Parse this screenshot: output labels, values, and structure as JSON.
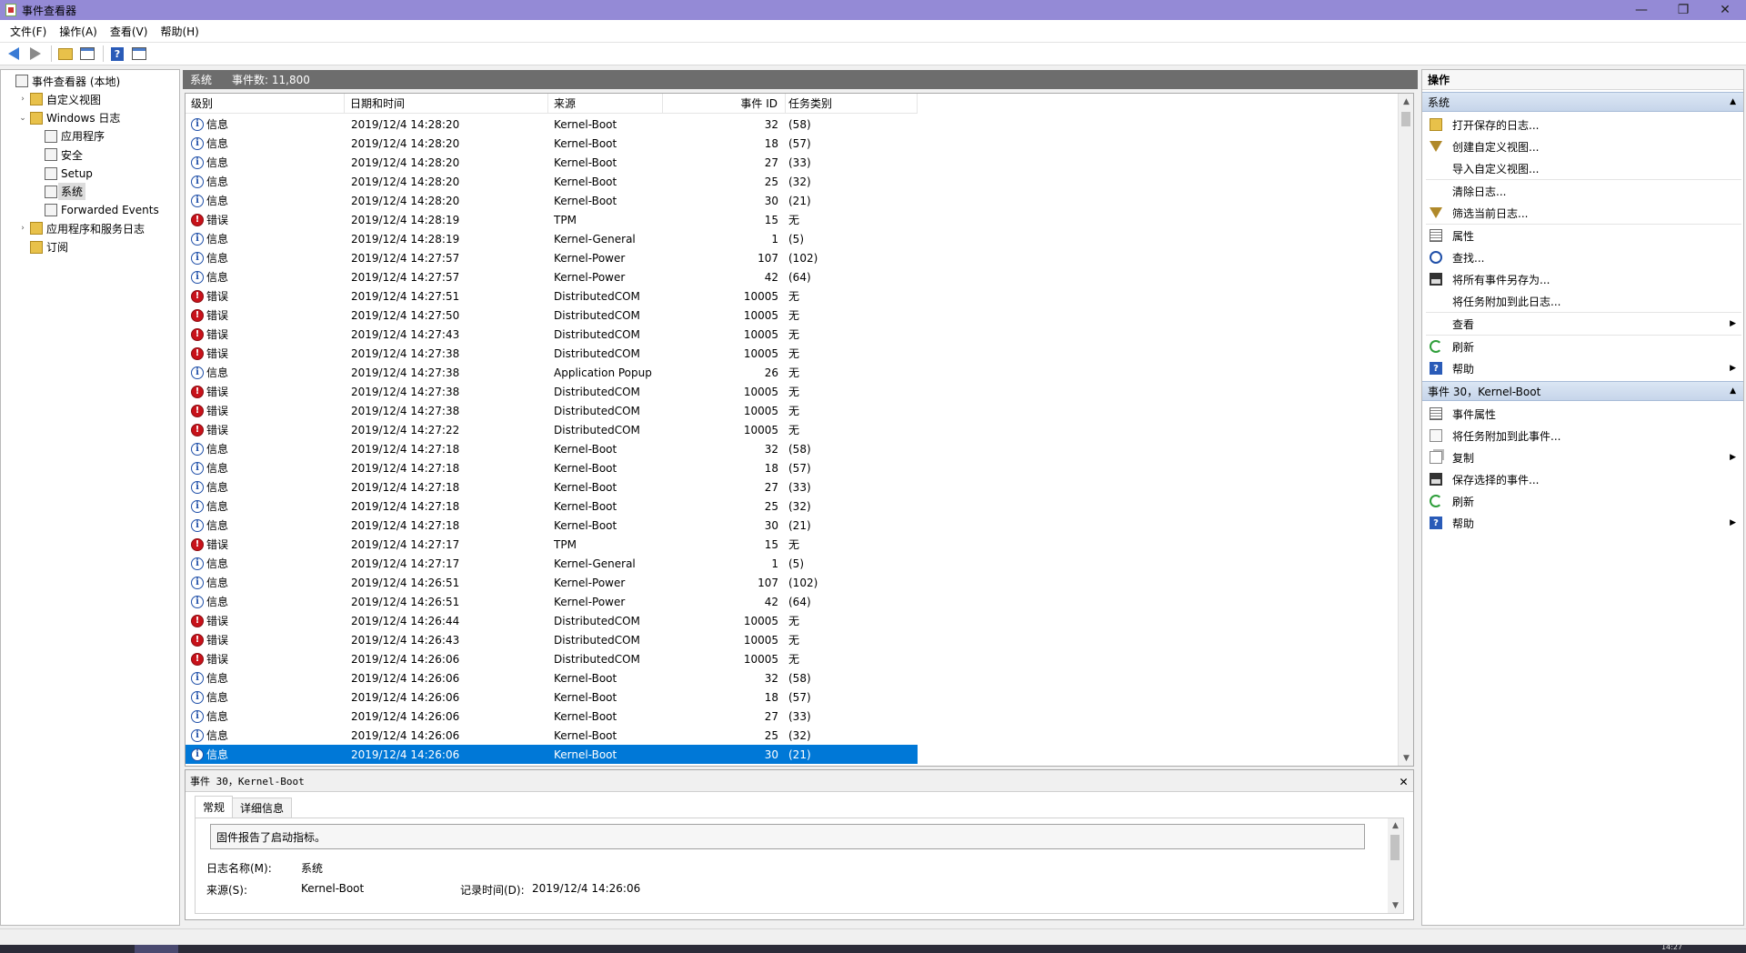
{
  "window": {
    "title": "事件查看器",
    "minimize": "—",
    "maximize": "❐",
    "close": "✕"
  },
  "menu": [
    "文件(F)",
    "操作(A)",
    "查看(V)",
    "帮助(H)"
  ],
  "toolbar": {
    "icons": [
      "back-arrow-icon",
      "forward-arrow-icon",
      "open-folder-icon",
      "show-hide-tree-icon",
      "help-icon",
      "action-pane-icon"
    ]
  },
  "tree": [
    {
      "label": "事件查看器 (本地)",
      "depth": 0,
      "expander": "",
      "icon": "event-viewer-icon"
    },
    {
      "label": "自定义视图",
      "depth": 1,
      "expander": "›",
      "icon": "folder-icon"
    },
    {
      "label": "Windows 日志",
      "depth": 1,
      "expander": "⌄",
      "icon": "folder-icon"
    },
    {
      "label": "应用程序",
      "depth": 2,
      "expander": "",
      "icon": "log-icon"
    },
    {
      "label": "安全",
      "depth": 2,
      "expander": "",
      "icon": "log-icon"
    },
    {
      "label": "Setup",
      "depth": 2,
      "expander": "",
      "icon": "log-icon"
    },
    {
      "label": "系统",
      "depth": 2,
      "expander": "",
      "icon": "log-icon",
      "selected": true
    },
    {
      "label": "Forwarded Events",
      "depth": 2,
      "expander": "",
      "icon": "log-icon"
    },
    {
      "label": "应用程序和服务日志",
      "depth": 1,
      "expander": "›",
      "icon": "folder-icon"
    },
    {
      "label": "订阅",
      "depth": 1,
      "expander": "",
      "icon": "folder-icon"
    }
  ],
  "list_header": {
    "log_name": "系统",
    "event_count": "事件数: 11,800"
  },
  "columns": [
    "级别",
    "日期和时间",
    "来源",
    "事件 ID",
    "任务类别"
  ],
  "events": [
    {
      "level": "信息",
      "type": "info",
      "date": "2019/12/4 14:28:20",
      "source": "Kernel-Boot",
      "id": "32",
      "task": "(58)"
    },
    {
      "level": "信息",
      "type": "info",
      "date": "2019/12/4 14:28:20",
      "source": "Kernel-Boot",
      "id": "18",
      "task": "(57)"
    },
    {
      "level": "信息",
      "type": "info",
      "date": "2019/12/4 14:28:20",
      "source": "Kernel-Boot",
      "id": "27",
      "task": "(33)"
    },
    {
      "level": "信息",
      "type": "info",
      "date": "2019/12/4 14:28:20",
      "source": "Kernel-Boot",
      "id": "25",
      "task": "(32)"
    },
    {
      "level": "信息",
      "type": "info",
      "date": "2019/12/4 14:28:20",
      "source": "Kernel-Boot",
      "id": "30",
      "task": "(21)"
    },
    {
      "level": "错误",
      "type": "error",
      "date": "2019/12/4 14:28:19",
      "source": "TPM",
      "id": "15",
      "task": "无"
    },
    {
      "level": "信息",
      "type": "info",
      "date": "2019/12/4 14:28:19",
      "source": "Kernel-General",
      "id": "1",
      "task": "(5)"
    },
    {
      "level": "信息",
      "type": "info",
      "date": "2019/12/4 14:27:57",
      "source": "Kernel-Power",
      "id": "107",
      "task": "(102)"
    },
    {
      "level": "信息",
      "type": "info",
      "date": "2019/12/4 14:27:57",
      "source": "Kernel-Power",
      "id": "42",
      "task": "(64)"
    },
    {
      "level": "错误",
      "type": "error",
      "date": "2019/12/4 14:27:51",
      "source": "DistributedCOM",
      "id": "10005",
      "task": "无"
    },
    {
      "level": "错误",
      "type": "error",
      "date": "2019/12/4 14:27:50",
      "source": "DistributedCOM",
      "id": "10005",
      "task": "无"
    },
    {
      "level": "错误",
      "type": "error",
      "date": "2019/12/4 14:27:43",
      "source": "DistributedCOM",
      "id": "10005",
      "task": "无"
    },
    {
      "level": "错误",
      "type": "error",
      "date": "2019/12/4 14:27:38",
      "source": "DistributedCOM",
      "id": "10005",
      "task": "无"
    },
    {
      "level": "信息",
      "type": "info",
      "date": "2019/12/4 14:27:38",
      "source": "Application Popup",
      "id": "26",
      "task": "无"
    },
    {
      "level": "错误",
      "type": "error",
      "date": "2019/12/4 14:27:38",
      "source": "DistributedCOM",
      "id": "10005",
      "task": "无"
    },
    {
      "level": "错误",
      "type": "error",
      "date": "2019/12/4 14:27:38",
      "source": "DistributedCOM",
      "id": "10005",
      "task": "无"
    },
    {
      "level": "错误",
      "type": "error",
      "date": "2019/12/4 14:27:22",
      "source": "DistributedCOM",
      "id": "10005",
      "task": "无"
    },
    {
      "level": "信息",
      "type": "info",
      "date": "2019/12/4 14:27:18",
      "source": "Kernel-Boot",
      "id": "32",
      "task": "(58)"
    },
    {
      "level": "信息",
      "type": "info",
      "date": "2019/12/4 14:27:18",
      "source": "Kernel-Boot",
      "id": "18",
      "task": "(57)"
    },
    {
      "level": "信息",
      "type": "info",
      "date": "2019/12/4 14:27:18",
      "source": "Kernel-Boot",
      "id": "27",
      "task": "(33)"
    },
    {
      "level": "信息",
      "type": "info",
      "date": "2019/12/4 14:27:18",
      "source": "Kernel-Boot",
      "id": "25",
      "task": "(32)"
    },
    {
      "level": "信息",
      "type": "info",
      "date": "2019/12/4 14:27:18",
      "source": "Kernel-Boot",
      "id": "30",
      "task": "(21)"
    },
    {
      "level": "错误",
      "type": "error",
      "date": "2019/12/4 14:27:17",
      "source": "TPM",
      "id": "15",
      "task": "无"
    },
    {
      "level": "信息",
      "type": "info",
      "date": "2019/12/4 14:27:17",
      "source": "Kernel-General",
      "id": "1",
      "task": "(5)"
    },
    {
      "level": "信息",
      "type": "info",
      "date": "2019/12/4 14:26:51",
      "source": "Kernel-Power",
      "id": "107",
      "task": "(102)"
    },
    {
      "level": "信息",
      "type": "info",
      "date": "2019/12/4 14:26:51",
      "source": "Kernel-Power",
      "id": "42",
      "task": "(64)"
    },
    {
      "level": "错误",
      "type": "error",
      "date": "2019/12/4 14:26:44",
      "source": "DistributedCOM",
      "id": "10005",
      "task": "无"
    },
    {
      "level": "错误",
      "type": "error",
      "date": "2019/12/4 14:26:43",
      "source": "DistributedCOM",
      "id": "10005",
      "task": "无"
    },
    {
      "level": "错误",
      "type": "error",
      "date": "2019/12/4 14:26:06",
      "source": "DistributedCOM",
      "id": "10005",
      "task": "无"
    },
    {
      "level": "信息",
      "type": "info",
      "date": "2019/12/4 14:26:06",
      "source": "Kernel-Boot",
      "id": "32",
      "task": "(58)"
    },
    {
      "level": "信息",
      "type": "info",
      "date": "2019/12/4 14:26:06",
      "source": "Kernel-Boot",
      "id": "18",
      "task": "(57)"
    },
    {
      "level": "信息",
      "type": "info",
      "date": "2019/12/4 14:26:06",
      "source": "Kernel-Boot",
      "id": "27",
      "task": "(33)"
    },
    {
      "level": "信息",
      "type": "info",
      "date": "2019/12/4 14:26:06",
      "source": "Kernel-Boot",
      "id": "25",
      "task": "(32)"
    },
    {
      "level": "信息",
      "type": "info",
      "date": "2019/12/4 14:26:06",
      "source": "Kernel-Boot",
      "id": "30",
      "task": "(21)",
      "selected": true
    }
  ],
  "detail": {
    "title": "事件 30，Kernel-Boot",
    "close": "✕",
    "tabs": [
      {
        "label": "常规",
        "active": true
      },
      {
        "label": "详细信息",
        "active": false
      }
    ],
    "message": "固件报告了启动指标。",
    "log_name_label": "日志名称(M):",
    "log_name_value": "系统",
    "source_label": "来源(S):",
    "source_value": "Kernel-Boot",
    "logged_label": "记录时间(D):",
    "logged_value": "2019/12/4 14:26:06"
  },
  "actions": {
    "title": "操作",
    "sections": [
      {
        "title": "系统",
        "items": [
          {
            "label": "打开保存的日志...",
            "icon": "open-folder-icon",
            "cls": "ai-open"
          },
          {
            "label": "创建自定义视图...",
            "icon": "filter-icon",
            "cls": "ai-filter"
          },
          {
            "label": "导入自定义视图...",
            "icon": "",
            "cls": "ai-none"
          },
          {
            "divider": true
          },
          {
            "label": "清除日志...",
            "icon": "",
            "cls": "ai-none"
          },
          {
            "label": "筛选当前日志...",
            "icon": "filter-icon",
            "cls": "ai-filter"
          },
          {
            "divider": true
          },
          {
            "label": "属性",
            "icon": "properties-icon",
            "cls": "ai-props"
          },
          {
            "label": "查找...",
            "icon": "find-icon",
            "cls": "ai-find"
          },
          {
            "label": "将所有事件另存为...",
            "icon": "save-icon",
            "cls": "ai-save"
          },
          {
            "label": "将任务附加到此日志...",
            "icon": "",
            "cls": "ai-none"
          },
          {
            "divider": true
          },
          {
            "label": "查看",
            "icon": "",
            "cls": "ai-none",
            "submenu": "▶"
          },
          {
            "divider": true
          },
          {
            "label": "刷新",
            "icon": "refresh-icon",
            "cls": "ai-refresh"
          },
          {
            "label": "帮助",
            "icon": "help-icon",
            "cls": "ai-help",
            "submenu": "▶"
          }
        ]
      },
      {
        "title": "事件 30，Kernel-Boot",
        "items": [
          {
            "label": "事件属性",
            "icon": "properties-icon",
            "cls": "ai-props"
          },
          {
            "label": "将任务附加到此事件...",
            "icon": "task-icon",
            "cls": "ai-task"
          },
          {
            "label": "复制",
            "icon": "copy-icon",
            "cls": "ai-copy",
            "submenu": "▶"
          },
          {
            "label": "保存选择的事件...",
            "icon": "save-icon",
            "cls": "ai-save"
          },
          {
            "label": "刷新",
            "icon": "refresh-icon",
            "cls": "ai-refresh"
          },
          {
            "label": "帮助",
            "icon": "help-icon",
            "cls": "ai-help",
            "submenu": "▶"
          }
        ]
      }
    ]
  },
  "taskbar": {
    "clock": "14:27"
  },
  "colors": {
    "titlebar": "#948ad6",
    "selection": "#0078d7",
    "error": "#c8121a",
    "info": "#1f4fa8"
  }
}
